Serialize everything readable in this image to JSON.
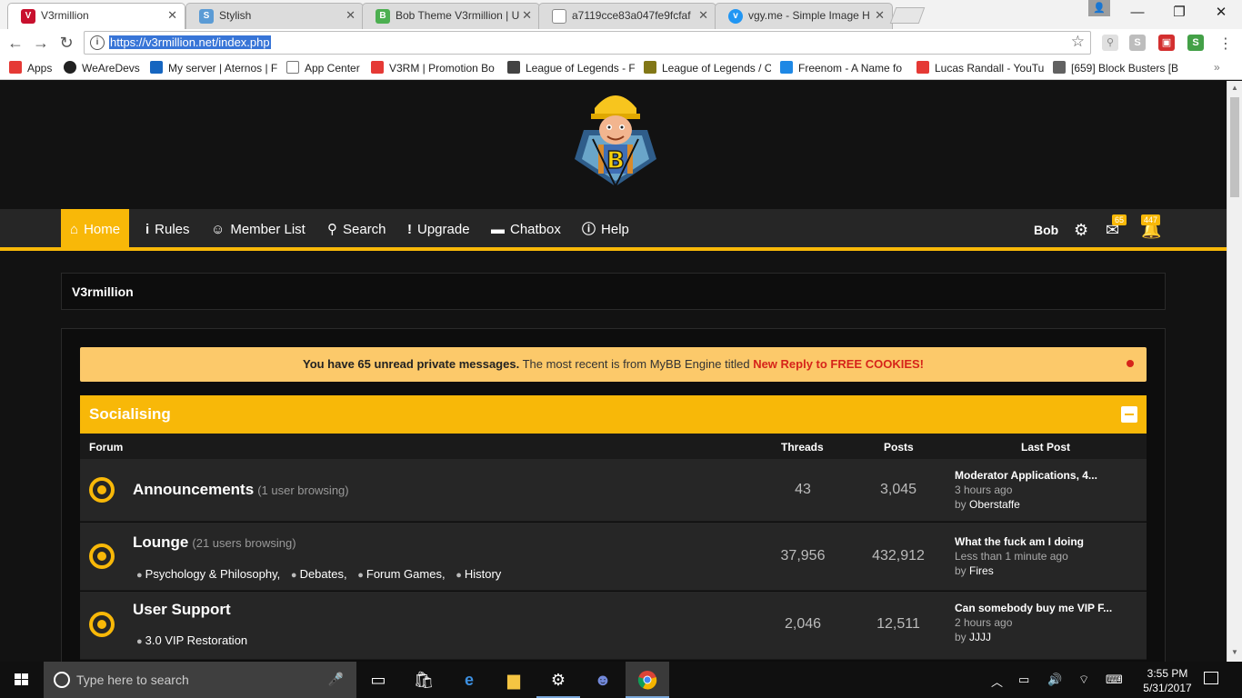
{
  "browser": {
    "tabs": [
      {
        "title": "V3rmillion",
        "icon_color": "#c8102e",
        "icon_char": "V"
      },
      {
        "title": "Stylish",
        "icon_color": "#5b9bd5",
        "icon_char": "S"
      },
      {
        "title": "Bob Theme V3rmillion | U",
        "icon_color": "#4caf50",
        "icon_char": "B"
      },
      {
        "title": "a7119cce83a047fe9fcfaf",
        "icon_color": "#9e9e9e",
        "icon_char": ""
      },
      {
        "title": "vgy.me - Simple Image H",
        "icon_color": "#2196f3",
        "icon_char": "v"
      }
    ],
    "url": "https://v3rmillion.net/index.php",
    "bookmarks": [
      {
        "label": "Apps",
        "color": "#e53935"
      },
      {
        "label": "WeAreDevs",
        "color": "#212121"
      },
      {
        "label": "My server | Aternos | F",
        "color": "#1565c0"
      },
      {
        "label": "App Center",
        "color": "#757575"
      },
      {
        "label": "V3RM | Promotion Bo",
        "color": "#e53935"
      },
      {
        "label": "League of Legends - F",
        "color": "#424242"
      },
      {
        "label": "League of Legends / C",
        "color": "#827717"
      },
      {
        "label": "Freenom - A Name fo",
        "color": "#1e88e5"
      },
      {
        "label": "Lucas Randall - YouTu",
        "color": "#e53935"
      },
      {
        "label": "[659] Block Busters [B",
        "color": "#616161"
      }
    ]
  },
  "nav": {
    "items": [
      {
        "label": "Home",
        "icon": "home-icon",
        "glyph": "⌂"
      },
      {
        "label": "Rules",
        "icon": "info-icon",
        "glyph": "i"
      },
      {
        "label": "Member List",
        "icon": "users-icon",
        "glyph": "☺"
      },
      {
        "label": "Search",
        "icon": "search-icon",
        "glyph": "⚲"
      },
      {
        "label": "Upgrade",
        "icon": "exclamation-icon",
        "glyph": "!"
      },
      {
        "label": "Chatbox",
        "icon": "comment-icon",
        "glyph": "▬"
      },
      {
        "label": "Help",
        "icon": "help-icon",
        "glyph": "ⓘ"
      }
    ],
    "username": "Bob",
    "messages_badge": "65",
    "alerts_badge": "447"
  },
  "site_title": "V3rmillion",
  "pm_alert": {
    "bold": "You have 65 unread private messages.",
    "text": "The most recent is from MyBB Engine titled",
    "link": "New Reply to FREE COOKIES!"
  },
  "category": {
    "title": "Socialising",
    "columns": {
      "forum": "Forum",
      "threads": "Threads",
      "posts": "Posts",
      "last_post": "Last Post"
    },
    "forums": [
      {
        "name": "Announcements",
        "viewing": "(1 user browsing)",
        "subforums": [],
        "threads": "43",
        "posts": "3,045",
        "last_title": "Moderator Applications, 4...",
        "last_time": "3 hours ago",
        "last_by": "by",
        "last_user": "Oberstaffe"
      },
      {
        "name": "Lounge",
        "viewing": "(21 users browsing)",
        "subforums": [
          "Psychology & Philosophy,",
          "Debates,",
          "Forum Games,",
          "History"
        ],
        "threads": "37,956",
        "posts": "432,912",
        "last_title": "What the fuck am I doing",
        "last_time": "Less than 1 minute ago",
        "last_by": "by",
        "last_user": "Fires"
      },
      {
        "name": "User Support",
        "viewing": "",
        "subforums": [
          "3.0 VIP Restoration"
        ],
        "threads": "2,046",
        "posts": "12,511",
        "last_title": "Can somebody buy me VIP F...",
        "last_time": "2 hours ago",
        "last_by": "by",
        "last_user": "JJJJ"
      }
    ]
  },
  "taskbar": {
    "search_placeholder": "Type here to search",
    "time": "3:55 PM",
    "date": "5/31/2017"
  },
  "colors": {
    "accent": "#f8b808",
    "alert_bg": "#fcc96a",
    "link_red": "#d6241a"
  }
}
